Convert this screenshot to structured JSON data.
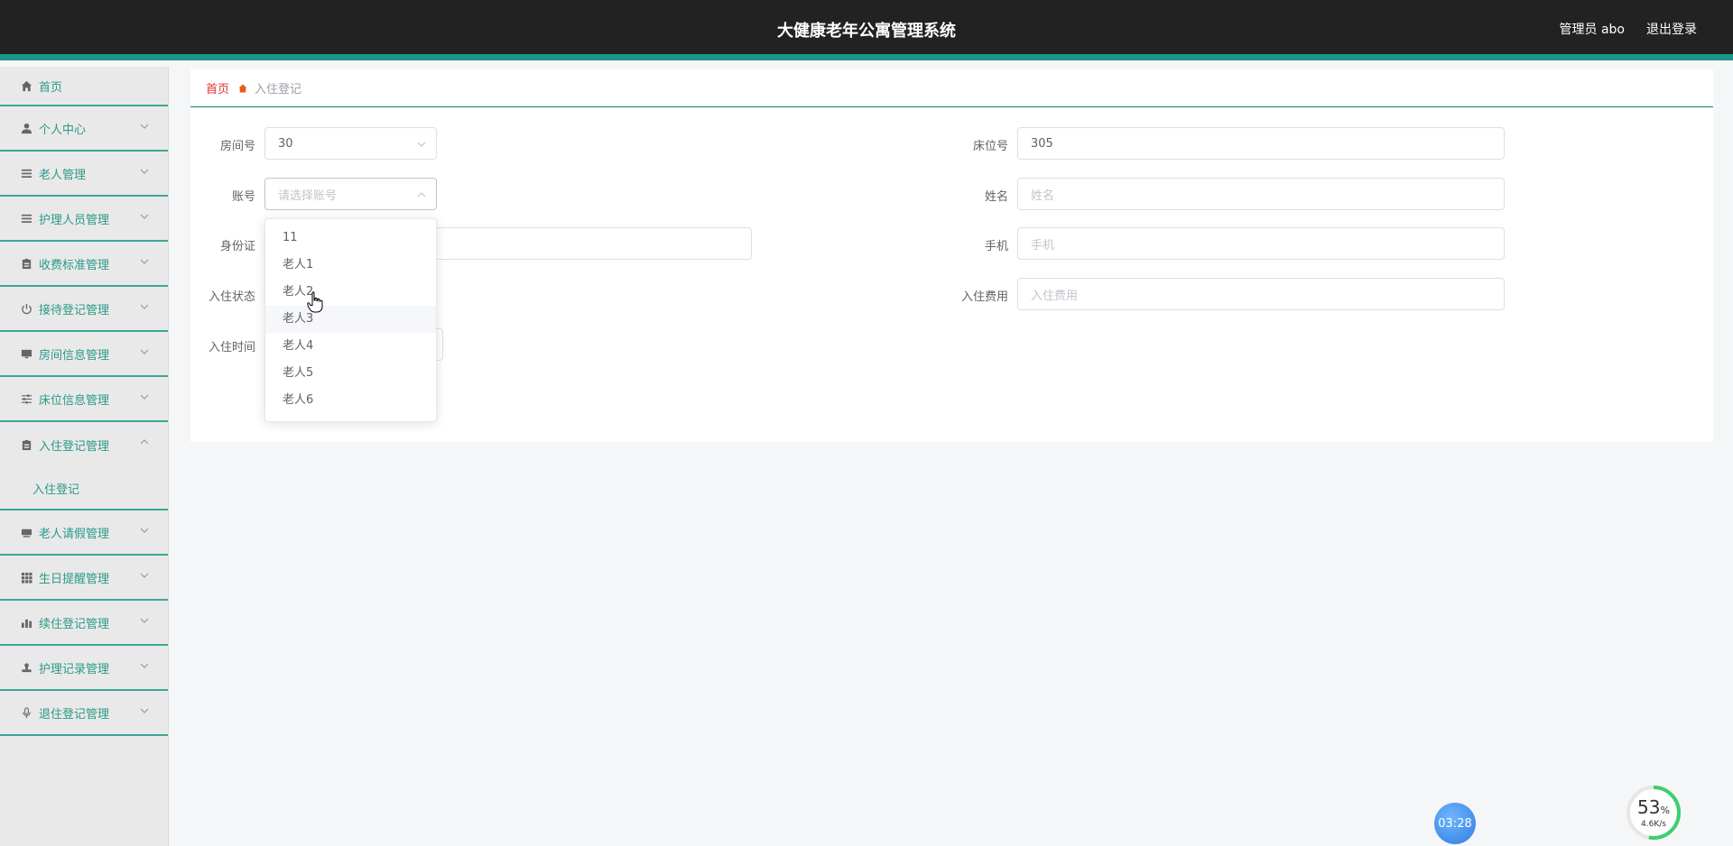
{
  "header": {
    "title": "大健康老年公寓管理系统",
    "user": "管理员 abo",
    "logout": "退出登录"
  },
  "sidebar": {
    "items": [
      {
        "label": "首页",
        "icon": "home-icon"
      },
      {
        "label": "个人中心",
        "icon": "user-icon"
      },
      {
        "label": "老人管理",
        "icon": "list-icon"
      },
      {
        "label": "护理人员管理",
        "icon": "list-icon"
      },
      {
        "label": "收费标准管理",
        "icon": "clipboard-icon"
      },
      {
        "label": "接待登记管理",
        "icon": "power-icon"
      },
      {
        "label": "房间信息管理",
        "icon": "monitor-icon"
      },
      {
        "label": "床位信息管理",
        "icon": "sliders-icon"
      },
      {
        "label": "入住登记管理",
        "icon": "clipboard-icon"
      },
      {
        "label": "老人请假管理",
        "icon": "inbox-icon"
      },
      {
        "label": "生日提醒管理",
        "icon": "grid-icon"
      },
      {
        "label": "续住登记管理",
        "icon": "bar-chart-icon"
      },
      {
        "label": "护理记录管理",
        "icon": "stamp-icon"
      },
      {
        "label": "退住登记管理",
        "icon": "mic-icon"
      }
    ],
    "subitem": "入住登记"
  },
  "breadcrumb": {
    "home": "首页",
    "current": "入住登记"
  },
  "form": {
    "room_label": "房间号",
    "room_value": "30",
    "bed_label": "床位号",
    "bed_value": "305",
    "account_label": "账号",
    "account_placeholder": "请选择账号",
    "name_label": "姓名",
    "name_placeholder": "姓名",
    "id_label": "身份证",
    "phone_label": "手机",
    "phone_placeholder": "手机",
    "status_label": "入住状态",
    "fee_label": "入住费用",
    "fee_placeholder": "入住费用",
    "time_label": "入住时间"
  },
  "dropdown": {
    "options": [
      "11",
      "老人1",
      "老人2",
      "老人3",
      "老人4",
      "老人5",
      "老人6"
    ],
    "hovered_index": 3
  },
  "widgets": {
    "timer": "03:28",
    "gauge_percent": "53",
    "gauge_unit": "%",
    "gauge_speed": "4.6K/s"
  },
  "colors": {
    "accent": "#1a9688",
    "menu_text": "#2a9a8a",
    "breadcrumb_home": "#e2352d"
  }
}
